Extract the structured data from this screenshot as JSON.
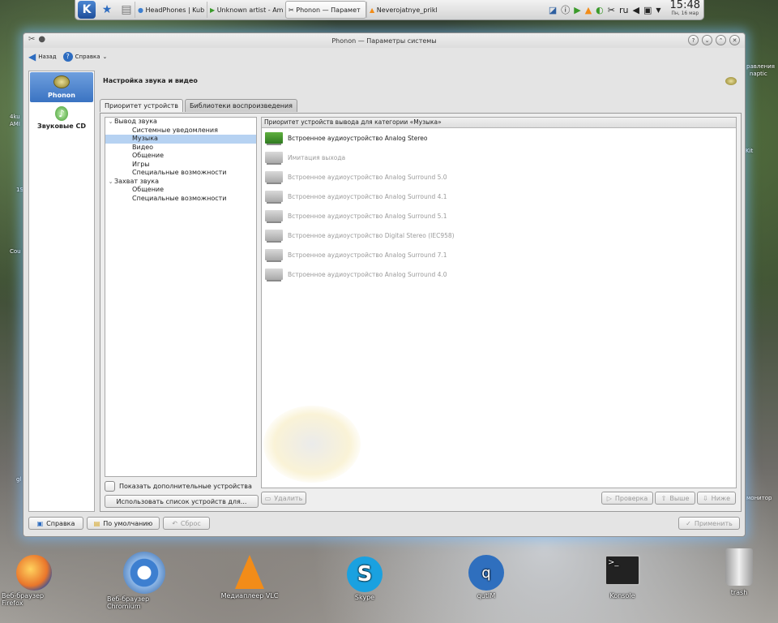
{
  "panel": {
    "k_label": "K",
    "tasks": [
      "HeadPhones | Kub",
      "Unknown artist - Am",
      "Phonon — Парамет",
      "Neverojatnye_prikl"
    ],
    "tray_lang": "ru",
    "clock_time": "15:48",
    "clock_date": "Пн, 16 мар"
  },
  "window": {
    "title": "Phonon — Параметры системы",
    "back_label": "Назад",
    "help_menu_label": "Справка",
    "sidebar": [
      {
        "label": "Phonon",
        "icon": "phonon-icon"
      },
      {
        "label": "Звуковые CD",
        "icon": "audio-cd-icon"
      }
    ],
    "heading": "Настройка звука и видео",
    "tabs": [
      "Приоритет устройств",
      "Библиотеки воспроизведения"
    ],
    "tree": [
      {
        "label": "Вывод звука",
        "level": 0,
        "toggle": "⌄"
      },
      {
        "label": "Системные уведомления",
        "level": 1
      },
      {
        "label": "Музыка",
        "level": 1,
        "selected": true
      },
      {
        "label": "Видео",
        "level": 1
      },
      {
        "label": "Общение",
        "level": 1
      },
      {
        "label": "Игры",
        "level": 1
      },
      {
        "label": "Специальные возможности",
        "level": 1
      },
      {
        "label": "Захват звука",
        "level": 0,
        "toggle": "⌄"
      },
      {
        "label": "Общение",
        "level": 1
      },
      {
        "label": "Специальные возможности",
        "level": 1
      }
    ],
    "show_more_label": "Показать дополнительные устройства",
    "use_list_button": "Использовать список устройств для...",
    "device_header": "Приоритет устройств вывода для категории «Музыка»",
    "devices": [
      {
        "label": "Встроенное аудиоустройство Analog Stereo",
        "enabled": true
      },
      {
        "label": "Имитация выхода",
        "enabled": false
      },
      {
        "label": "Встроенное аудиоустройство Analog Surround 5.0",
        "enabled": false
      },
      {
        "label": "Встроенное аудиоустройство Analog Surround 4.1",
        "enabled": false
      },
      {
        "label": "Встроенное аудиоустройство Analog Surround 5.1",
        "enabled": false
      },
      {
        "label": "Встроенное аудиоустройство Digital Stereo (IEC958)",
        "enabled": false
      },
      {
        "label": "Встроенное аудиоустройство Analog Surround 7.1",
        "enabled": false
      },
      {
        "label": "Встроенное аудиоустройство Analog Surround 4.0",
        "enabled": false
      }
    ],
    "buttons": {
      "remove": "Удалить",
      "test": "Проверка",
      "up": "Выше",
      "down": "Ниже",
      "help": "Справка",
      "defaults": "По умолчанию",
      "reset": "Сброс",
      "apply": "Применить"
    }
  },
  "desktop": {
    "icons": [
      {
        "label": "Веб-браузер Firefox",
        "color": "#e9762b"
      },
      {
        "label": "Веб-браузер Chromium",
        "color": "#3d7fd0"
      },
      {
        "label": "Медиаплеер VLC",
        "color": "#f28c18"
      },
      {
        "label": "Skype",
        "color": "#1aa1e0"
      },
      {
        "label": "qutIM",
        "color": "#2f6fbe"
      },
      {
        "label": "Konsole",
        "color": "#222222"
      },
      {
        "label": "trash",
        "color": "#c8c8c8"
      }
    ],
    "edge_left": [
      "4ku",
      "AMI",
      "1S",
      "Cou",
      "gl"
    ],
    "edge_right": [
      "равления",
      "naptic",
      "Kit",
      "монитор"
    ]
  },
  "colors": {
    "accent": "#3a73c2",
    "selection": "#b6d2f2",
    "disabled_text": "#9b9b9b"
  }
}
